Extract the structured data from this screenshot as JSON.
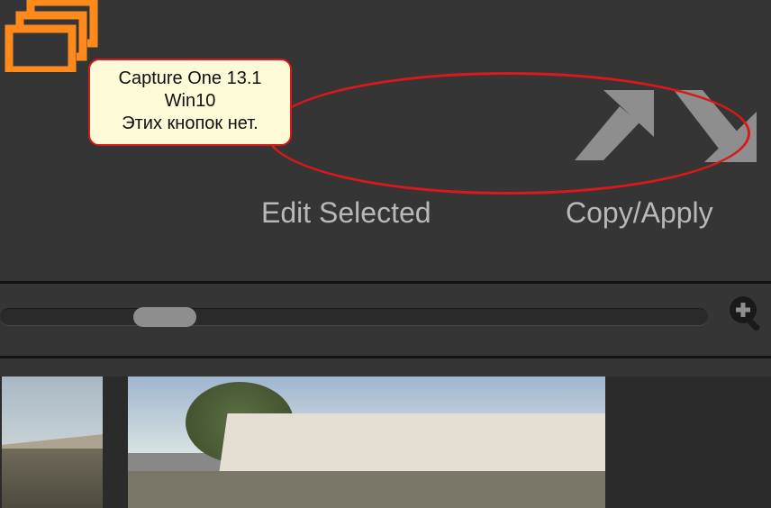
{
  "toolbar": {
    "edit_selected_label": "Edit Selected",
    "copy_apply_label": "Copy/Apply"
  },
  "annotation": {
    "line1": "Capture One 13.1",
    "line2": "Win10",
    "line3": "Этих кнопок нет."
  },
  "icons": {
    "edit_selected": "stack-rectangles-icon",
    "copy_arrow_up": "arrow-up-right-icon",
    "copy_arrow_down": "arrow-down-right-icon",
    "zoom": "magnifier-plus-icon"
  },
  "colors": {
    "edit_selected_icon": "#ff8a1b",
    "arrow_icon": "#8e8e8e",
    "zoom_icon": "#1a1a1a",
    "annotation_bg": "#fefbd8",
    "annotation_border": "#d8181a"
  }
}
